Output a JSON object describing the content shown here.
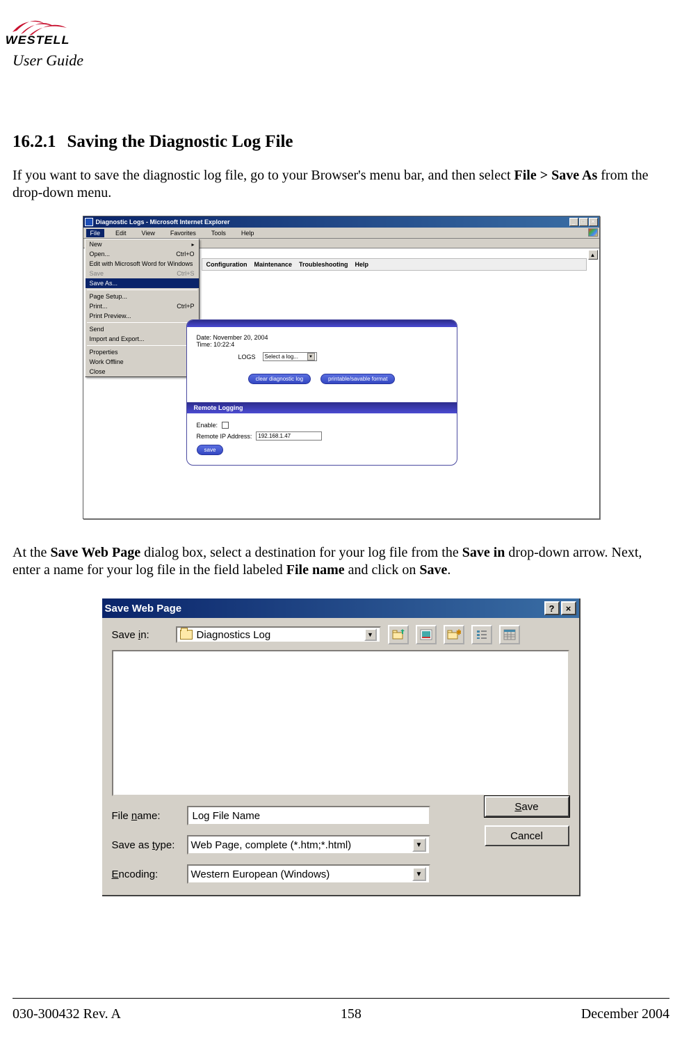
{
  "header": {
    "brand": "WESTELL",
    "guide": "User Guide"
  },
  "section": {
    "number": "16.2.1",
    "title": "Saving the Diagnostic Log File"
  },
  "para1": {
    "pre": "If you want to save the diagnostic log file, go to your Browser's menu bar, and then select ",
    "bold": "File > Save As",
    "post": " from the drop-down menu."
  },
  "browser": {
    "title": "Diagnostic Logs - Microsoft Internet Explorer",
    "window_min": "_",
    "window_max": "□",
    "window_close": "×",
    "menu": {
      "file": "File",
      "edit": "Edit",
      "view": "View",
      "favorites": "Favorites",
      "tools": "Tools",
      "help": "Help"
    },
    "scroll_up": "▲",
    "filemenu": {
      "new": "New",
      "open": "Open...",
      "open_sc": "Ctrl+O",
      "editwith": "Edit with Microsoft Word for Windows",
      "save": "Save",
      "save_sc": "Ctrl+S",
      "saveas": "Save As...",
      "pagesetup": "Page Setup...",
      "print": "Print...",
      "print_sc": "Ctrl+P",
      "printpreview": "Print Preview...",
      "send": "Send",
      "importexport": "Import and Export...",
      "properties": "Properties",
      "workoffline": "Work Offline",
      "close": "Close"
    },
    "tabs": {
      "configuration": "Configuration",
      "maintenance": "Maintenance",
      "troubleshooting": "Troubleshooting",
      "help": "Help"
    },
    "panel": {
      "date": "Date: November 20, 2004",
      "time": "Time: 10:22:4",
      "logs_label": "LOGS",
      "logs_select": "Select a log...",
      "clear_btn": "clear diagnostic log",
      "printable_btn": "printable/savable format",
      "remote_heading": "Remote Logging",
      "enable_label": "Enable:",
      "remote_ip_label": "Remote IP Address:",
      "remote_ip_value": "192.168.1.47",
      "save_btn": "save"
    }
  },
  "para2": {
    "t1": "At the ",
    "b1": "Save Web Page",
    "t2": " dialog box, select a destination for your log file from the ",
    "b2": "Save in",
    "t3": " drop-down arrow. Next, enter a name for your log file in the field labeled ",
    "b3": "File name",
    "t4": " and click on ",
    "b4": "Save",
    "t5": "."
  },
  "dialog": {
    "title": "Save Web Page",
    "help_btn": "?",
    "close_btn": "×",
    "save_in_label": "Save in:",
    "save_in_folder": "Diagnostics Log",
    "file_name_label": "File name:",
    "file_name_value": "Log File Name",
    "save_as_type_label": "Save as type:",
    "save_as_type_value": "Web Page, complete (*.htm;*.html)",
    "encoding_label": "Encoding:",
    "encoding_value": "Western European (Windows)",
    "save_btn": "Save",
    "cancel_btn": "Cancel",
    "dd_glyph": "▼"
  },
  "footer": {
    "left": "030-300432 Rev. A",
    "center": "158",
    "right": "December 2004"
  }
}
